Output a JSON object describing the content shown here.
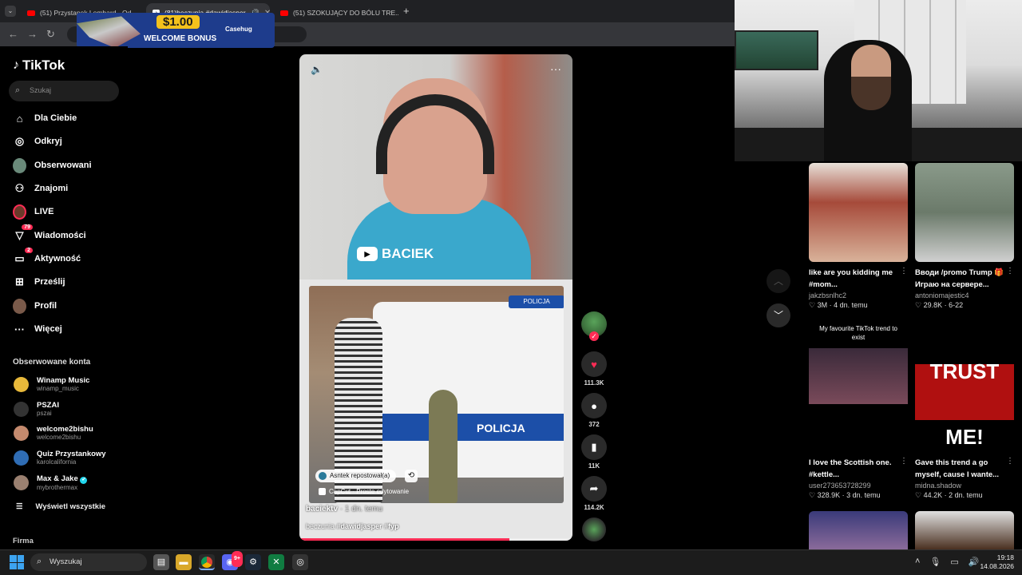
{
  "browser": {
    "tabs": [
      {
        "title": "(51) Przystanek Lombard - Od...",
        "icon": "youtube-icon",
        "active": false
      },
      {
        "title": "(81)beczunia #dawidjasper",
        "icon": "tiktok-icon",
        "active": true
      },
      {
        "title": "(51) SZOKUJĄCY DO BÓLU TRE...",
        "icon": "youtube-icon",
        "active": false
      }
    ],
    "new_tab": "+",
    "url": "tikto"
  },
  "ad": {
    "amount": "$1.00",
    "bonus": "WELCOME BONUS",
    "brand": "Casehug"
  },
  "tiktok": {
    "logo": "TikTok",
    "search_placeholder": "Szukaj",
    "nav": [
      {
        "label": "Dla Ciebie",
        "icon": "home-icon"
      },
      {
        "label": "Odkryj",
        "icon": "compass-icon"
      },
      {
        "label": "Obserwowani",
        "icon": "avatar-icon"
      },
      {
        "label": "Znajomi",
        "icon": "friends-icon"
      },
      {
        "label": "LIVE",
        "icon": "live-icon"
      },
      {
        "label": "Wiadomości",
        "icon": "messages-icon",
        "badge": "79"
      },
      {
        "label": "Aktywność",
        "icon": "activity-icon",
        "badge": "2"
      },
      {
        "label": "Prześlij",
        "icon": "upload-icon"
      },
      {
        "label": "Profil",
        "icon": "profile-icon"
      },
      {
        "label": "Więcej",
        "icon": "more-icon"
      }
    ],
    "following_title": "Obserwowane konta",
    "following": [
      {
        "name": "Winamp Music",
        "handle": "winamp_music",
        "color": "#e8b93a"
      },
      {
        "name": "PSZAI",
        "handle": "pszai",
        "color": "#333333"
      },
      {
        "name": "welcome2bishu",
        "handle": "welcome2bishu",
        "color": "#c48a6e"
      },
      {
        "name": "Quiz Przystankowy",
        "handle": "karolcalifornia",
        "color": "#2f6db5"
      },
      {
        "name": "Max & Jake",
        "handle": "mybrothermax",
        "color": "#9a8070",
        "verified": "✔"
      }
    ],
    "show_all": "Wyświetl wszystkie",
    "company": "Firma"
  },
  "video": {
    "overlay_badge": "BACIEK",
    "car_label": "POLICJA",
    "car_roof": "POLICJA",
    "repost": "Asntek repostował(a)",
    "capcut": "CapCut · Proste edytowanie",
    "author": "baciektv",
    "date": "· 1 dn. temu",
    "desc_prefix": "beczunia ",
    "hashtags": "#dawidjasper  #fyp",
    "progress": 0.77,
    "actions": {
      "likes": "111.3K",
      "comments": "372",
      "saves": "11K",
      "shares": "114.2K"
    }
  },
  "feed": [
    {
      "title": "like are you kidding me #mom...",
      "user": "jakzbsnlhc2",
      "meta": "♡ 3M · 4 dn. temu",
      "colors": [
        "#a64a3a",
        "#d9b29a"
      ]
    },
    {
      "title": "Вводи /promo Trump 🎁 Играю на сервере...",
      "user": "antoniomajestic4",
      "meta": "♡ 29.8K · 6-22",
      "colors": [
        "#6b7a6a",
        "#b3b3b3"
      ]
    },
    {
      "title": "I love the Scottish one. #kettle...",
      "user": "user273653728299",
      "meta": "♡ 328.9K · 3 dn. temu",
      "overlay": "My favourite TikTok trend to exist",
      "colors": [
        "#3a2a3a",
        "#7a4a5a"
      ]
    },
    {
      "title": "Gave this trend a go myself, cause I wante...",
      "user": "midna.shadow",
      "meta": "♡ 44.2K · 2 dn. temu",
      "overlay": "TRUST ME!",
      "colors": [
        "#000000",
        "#b01010"
      ]
    }
  ],
  "taskbar": {
    "search": "Wyszukaj",
    "time": "19:18",
    "date": "14.08.2026",
    "discord_badge": "9+"
  }
}
